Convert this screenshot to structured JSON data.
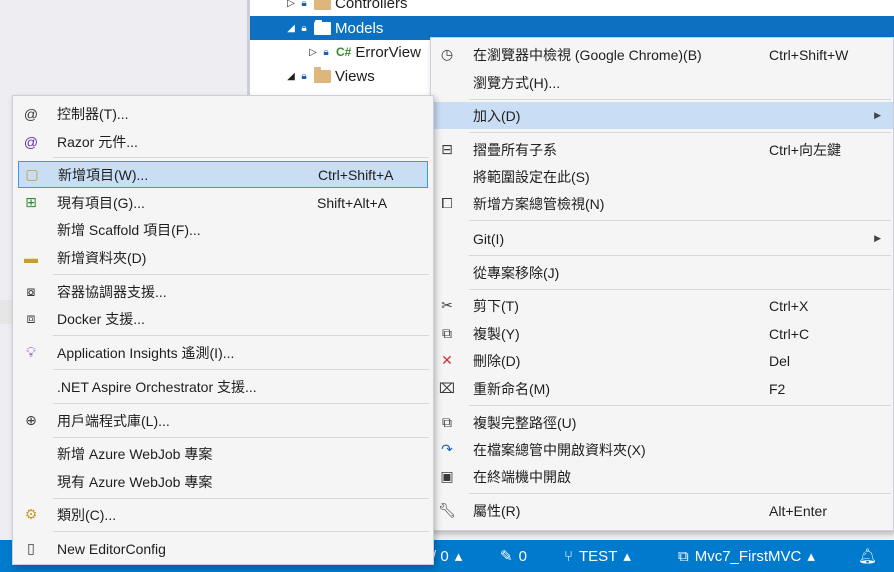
{
  "solution_explorer": {
    "rows": [
      {
        "label": "Controllers"
      },
      {
        "label": "Models"
      },
      {
        "label": "ErrorView",
        "type_badge": "C#"
      },
      {
        "label": "Views"
      }
    ]
  },
  "context_menu": {
    "items": [
      {
        "label": "在瀏覽器中檢視 (Google Chrome)(B)",
        "shortcut": "Ctrl+Shift+W",
        "icon": "browser-view-icon"
      },
      {
        "label": "瀏覽方式(H)...",
        "shortcut": ""
      },
      {
        "label": "加入(D)",
        "has_submenu": true
      },
      {
        "label": "摺疊所有子系",
        "shortcut": "Ctrl+向左鍵",
        "icon": "collapse-all-icon"
      },
      {
        "label": "將範圍設定在此(S)",
        "shortcut": ""
      },
      {
        "label": "新增方案總管檢視(N)",
        "shortcut": "",
        "icon": "new-solution-view-icon"
      },
      {
        "label": "Git(I)",
        "has_submenu": true
      },
      {
        "label": "從專案移除(J)",
        "shortcut": ""
      },
      {
        "label": "剪下(T)",
        "shortcut": "Ctrl+X",
        "icon": "cut-icon"
      },
      {
        "label": "複製(Y)",
        "shortcut": "Ctrl+C",
        "icon": "copy-icon"
      },
      {
        "label": "刪除(D)",
        "shortcut": "Del",
        "icon": "delete-icon"
      },
      {
        "label": "重新命名(M)",
        "shortcut": "F2",
        "icon": "rename-icon"
      },
      {
        "label": "複製完整路徑(U)",
        "shortcut": "",
        "icon": "copy-full-path-icon"
      },
      {
        "label": "在檔案總管中開啟資料夾(X)",
        "shortcut": "",
        "icon": "open-folder-explorer-icon"
      },
      {
        "label": "在終端機中開啟",
        "shortcut": "",
        "icon": "terminal-icon"
      },
      {
        "label": "屬性(R)",
        "shortcut": "Alt+Enter",
        "icon": "properties-wrench-icon"
      }
    ]
  },
  "add_submenu": {
    "items": [
      {
        "label": "控制器(T)...",
        "shortcut": "",
        "icon": "controller-icon"
      },
      {
        "label": "Razor 元件...",
        "shortcut": "",
        "icon": "razor-component-icon"
      },
      {
        "label": "新增項目(W)...",
        "shortcut": "Ctrl+Shift+A",
        "icon": "new-item-icon"
      },
      {
        "label": "現有項目(G)...",
        "shortcut": "Shift+Alt+A",
        "icon": "existing-item-icon"
      },
      {
        "label": "新增 Scaffold 項目(F)...",
        "shortcut": ""
      },
      {
        "label": "新增資料夾(D)",
        "shortcut": "",
        "icon": "new-folder-icon"
      },
      {
        "label": "容器協調器支援...",
        "shortcut": "",
        "icon": "container-orchestrator-icon"
      },
      {
        "label": "Docker 支援...",
        "shortcut": "",
        "icon": "docker-icon"
      },
      {
        "label": "Application Insights 遙測(I)...",
        "shortcut": "",
        "icon": "application-insights-icon"
      },
      {
        "label": ".NET Aspire Orchestrator 支援...",
        "shortcut": ""
      },
      {
        "label": "用戶端程式庫(L)...",
        "shortcut": "",
        "icon": "client-library-icon"
      },
      {
        "label": "新增 Azure WebJob 專案",
        "shortcut": ""
      },
      {
        "label": "現有 Azure WebJob 專案",
        "shortcut": ""
      },
      {
        "label": "類別(C)...",
        "shortcut": "",
        "icon": "class-icon"
      },
      {
        "label": "New EditorConfig",
        "shortcut": "",
        "icon": "editorconfig-icon"
      }
    ]
  },
  "status_bar": {
    "errors": "/ 0",
    "pending_changes": "0",
    "branch": "TEST",
    "project": "Mvc7_FirstMVC"
  },
  "colors": {
    "status_bar": "#007acc",
    "selection": "#0e70c0",
    "menu_highlight": "#c9def5",
    "menu_highlight_border": "#3399ff"
  }
}
